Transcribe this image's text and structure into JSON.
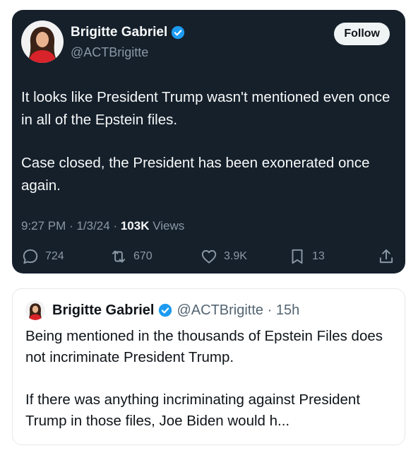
{
  "tweet": {
    "author_name": "Brigitte Gabriel",
    "author_handle": "@ACTBrigitte",
    "follow_label": "Follow",
    "text_paragraph_1": "It looks like President Trump wasn't mentioned even once in all of the Epstein files.",
    "text_paragraph_2": "Case closed, the President has been exonerated once again.",
    "time": "9:27 PM",
    "date": "1/3/24",
    "views_count": "103K",
    "views_label": "Views",
    "replies": "724",
    "retweets": "670",
    "likes": "3.9K",
    "bookmarks": "13"
  },
  "quoted_tweet": {
    "author_name": "Brigitte Gabriel",
    "author_handle": "@ACTBrigitte",
    "age": "15h",
    "text_paragraph_1": "Being mentioned in the thousands of Epstein Files does not incriminate President Trump.",
    "text_paragraph_2": "If there was anything incriminating against President Trump in those files, Joe Biden would h..."
  },
  "colors": {
    "dark_bg": "#15202b",
    "verified_blue": "#1d9bf0",
    "muted_gray": "#8b98a5"
  }
}
